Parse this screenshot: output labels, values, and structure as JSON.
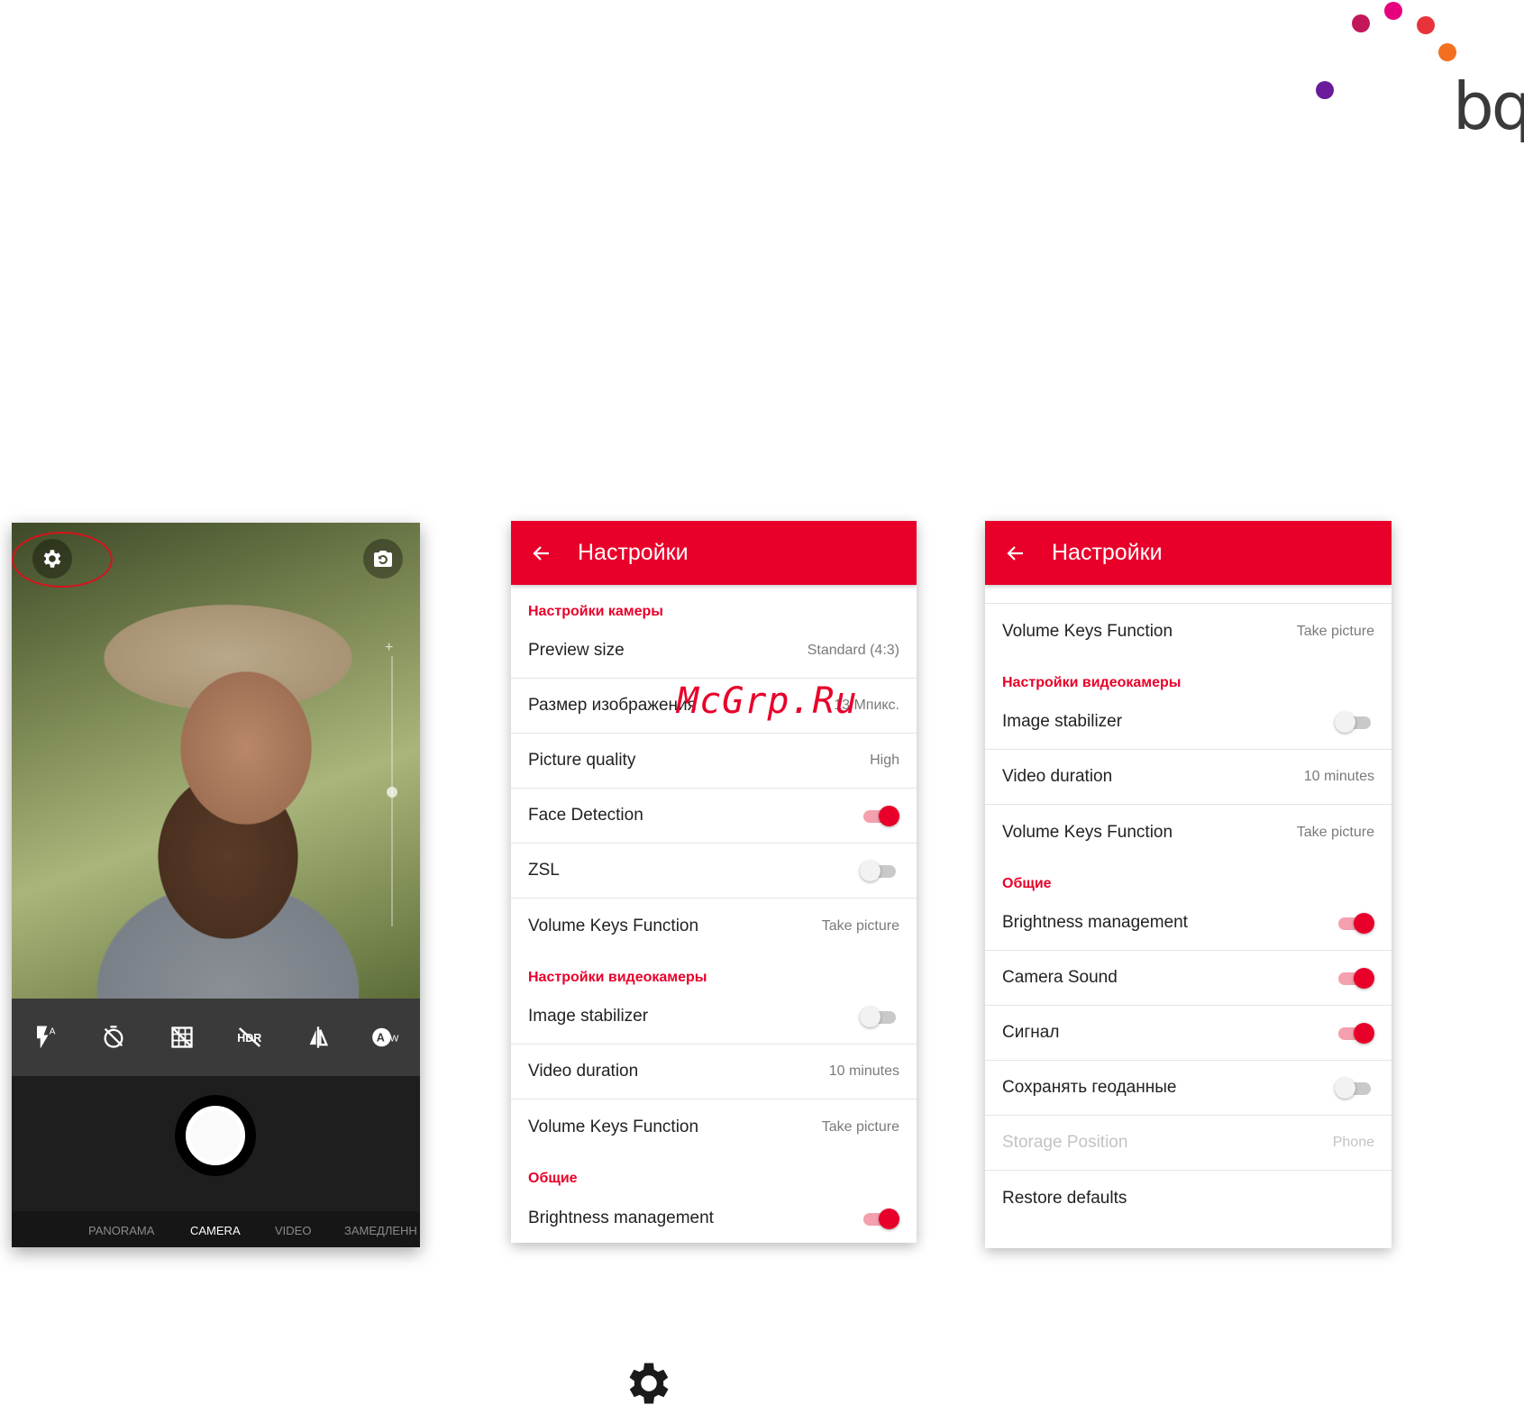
{
  "brand": {
    "logo_text": "bq",
    "dot_colors": [
      "#c2185b",
      "#e6007e",
      "#e8333a",
      "#f36f21",
      "#6a1b9a"
    ]
  },
  "camera_screen": {
    "icons": [
      "settings-icon",
      "switch-camera-icon",
      "flash-auto-icon",
      "timer-off-icon",
      "grid-off-icon",
      "hdr-off-icon",
      "mirror-icon",
      "auto-white-balance-icon"
    ],
    "zoom_plus": "+",
    "modes": [
      {
        "label": "PANORAMA",
        "active": false
      },
      {
        "label": "CAMERA",
        "active": true
      },
      {
        "label": "VIDEO",
        "active": false
      },
      {
        "label": "ЗАМЕДЛЕНН",
        "active": false
      }
    ]
  },
  "settings_panel_1": {
    "title": "Настройки",
    "sections": {
      "camera": "Настройки камеры",
      "video": "Настройки видеокамеры",
      "general": "Общие"
    },
    "rows": {
      "preview_size": {
        "label": "Preview size",
        "value": "Standard (4:3)"
      },
      "image_size": {
        "label": "Размер изображения",
        "value": "13 Мпикс."
      },
      "picture_quality": {
        "label": "Picture quality",
        "value": "High"
      },
      "face_detection": {
        "label": "Face Detection",
        "on": true
      },
      "zsl": {
        "label": "ZSL",
        "on": false
      },
      "volume_keys": {
        "label": "Volume Keys Function",
        "value": "Take picture"
      },
      "image_stabilizer": {
        "label": "Image stabilizer",
        "on": false
      },
      "video_duration": {
        "label": "Video duration",
        "value": "10 minutes"
      },
      "volume_keys_video": {
        "label": "Volume Keys Function",
        "value": "Take picture"
      },
      "brightness": {
        "label": "Brightness management",
        "on": true
      }
    }
  },
  "settings_panel_2": {
    "title": "Настройки",
    "sections": {
      "video": "Настройки видеокамеры",
      "general": "Общие"
    },
    "rows": {
      "volume_keys": {
        "label": "Volume Keys Function",
        "value": "Take picture"
      },
      "image_stabilizer": {
        "label": "Image stabilizer",
        "on": false
      },
      "video_duration": {
        "label": "Video duration",
        "value": "10 minutes"
      },
      "volume_keys_video": {
        "label": "Volume Keys Function",
        "value": "Take picture"
      },
      "brightness": {
        "label": "Brightness management",
        "on": true
      },
      "camera_sound": {
        "label": "Camera Sound",
        "on": true
      },
      "signal": {
        "label": "Сигнал",
        "on": true
      },
      "geodata": {
        "label": "Сохранять геоданные",
        "on": false
      },
      "storage": {
        "label": "Storage Position",
        "value": "Phone",
        "disabled": true
      },
      "restore": {
        "label": "Restore defaults"
      }
    }
  },
  "watermark": "McGrp.Ru",
  "colors": {
    "accent": "#e8002a",
    "toggle_on_track": "#f5a0ae",
    "highlight_ellipse": "#d8121e"
  },
  "bottom_icon": "settings-gear-icon"
}
